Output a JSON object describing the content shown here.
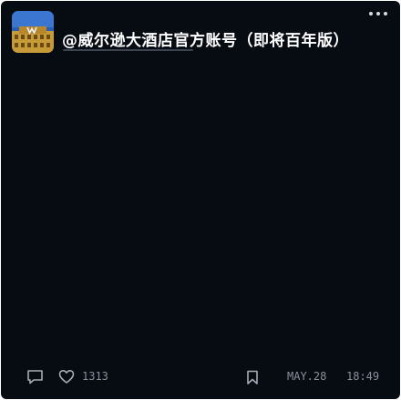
{
  "post": {
    "title": "@威尔逊大酒店官方账号（即将百年版）",
    "avatar_icon": "hotel-building-icon",
    "more_icon": "more-dots-icon"
  },
  "footer": {
    "comment_icon": "comment-icon",
    "like_icon": "heart-icon",
    "like_count": "1313",
    "bookmark_icon": "bookmark-icon",
    "date": "MAY.28",
    "time": "18:49"
  },
  "colors": {
    "background": "#070b12",
    "title": "#ffffff",
    "meta": "#8a8f9a"
  }
}
